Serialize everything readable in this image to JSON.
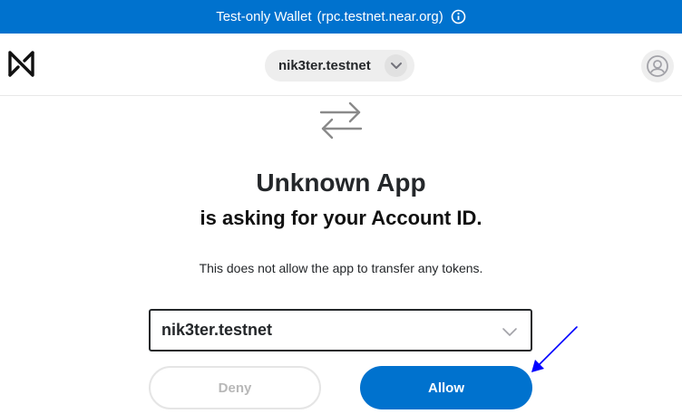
{
  "banner": {
    "text": "Test-only Wallet",
    "rpc": "(rpc.testnet.near.org)",
    "icon": "info-icon"
  },
  "navbar": {
    "logo_icon": "near-logo-icon",
    "account": "nik3ter.testnet",
    "account_chevron_icon": "chevron-down-icon",
    "user_icon": "user-icon"
  },
  "main": {
    "swap_icon": "swap-arrows-icon",
    "title": "Unknown App",
    "subtitle": "is asking for your Account ID.",
    "description": "This does not allow the app to transfer any tokens.",
    "account_select": {
      "selected": "nik3ter.testnet",
      "icon": "chevron-down-icon"
    },
    "deny_label": "Deny",
    "allow_label": "Allow"
  },
  "annotation": {
    "icon": "arrow-pointer-icon",
    "color": "#0000ff"
  },
  "colors": {
    "brand_blue": "#0072ce",
    "text": "#24272a"
  }
}
